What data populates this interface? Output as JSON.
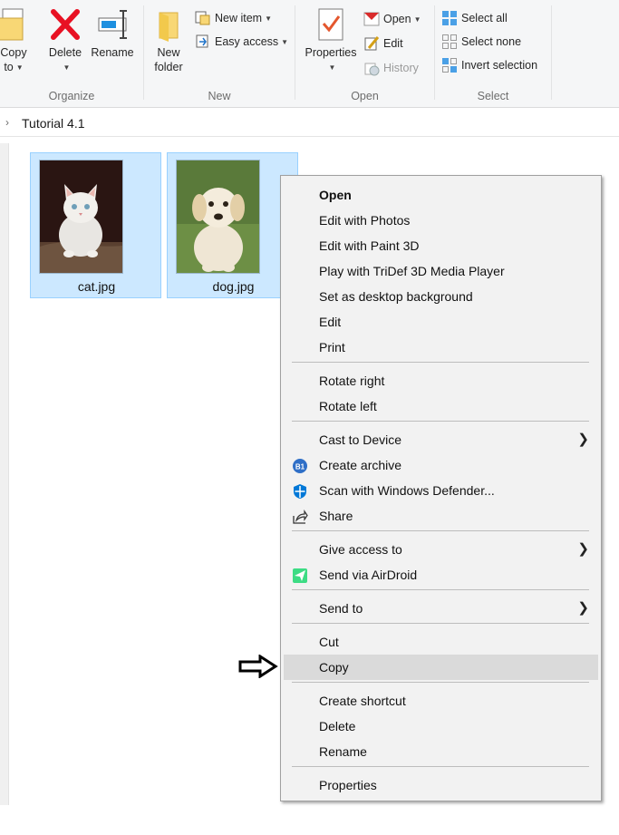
{
  "ribbon": {
    "organize": {
      "copy_to_label_1": "Copy",
      "copy_to_label_2": "to",
      "delete_label": "Delete",
      "rename_label": "Rename",
      "group_label": "Organize"
    },
    "new": {
      "new_folder_label_1": "New",
      "new_folder_label_2": "folder",
      "new_item_label": "New item",
      "easy_access_label": "Easy access",
      "group_label": "New"
    },
    "open": {
      "properties_label": "Properties",
      "open_label": "Open",
      "edit_label": "Edit",
      "history_label": "History",
      "group_label": "Open"
    },
    "select": {
      "select_all_label": "Select all",
      "select_none_label": "Select none",
      "invert_selection_label": "Invert selection",
      "group_label": "Select"
    }
  },
  "address": {
    "breadcrumb": "Tutorial 4.1"
  },
  "files": [
    {
      "name": "cat.jpg"
    },
    {
      "name": "dog.jpg"
    }
  ],
  "context_menu": {
    "items": [
      {
        "label": "Open"
      },
      {
        "label": "Edit with Photos"
      },
      {
        "label": "Edit with Paint 3D"
      },
      {
        "label": "Play with TriDef 3D Media Player"
      },
      {
        "label": "Set as desktop background"
      },
      {
        "label": "Edit"
      },
      {
        "label": "Print"
      },
      {
        "label": "Rotate right"
      },
      {
        "label": "Rotate left"
      },
      {
        "label": "Cast to Device"
      },
      {
        "label": "Create archive",
        "icon_text": "B1"
      },
      {
        "label": "Scan with Windows Defender..."
      },
      {
        "label": "Share"
      },
      {
        "label": "Give access to"
      },
      {
        "label": "Send via AirDroid"
      },
      {
        "label": "Send to"
      },
      {
        "label": "Cut"
      },
      {
        "label": "Copy"
      },
      {
        "label": "Create shortcut"
      },
      {
        "label": "Delete"
      },
      {
        "label": "Rename"
      },
      {
        "label": "Properties"
      }
    ],
    "highlighted_item": "Copy"
  },
  "colors": {
    "ribbon_bg": "#f5f6f7",
    "selection_fill": "#cce8ff",
    "selection_border": "#99d1ff",
    "menu_bg": "#f2f2f2",
    "menu_hover": "#dadada",
    "delete_red": "#e81123",
    "folder_yellow": "#f8d775",
    "airdroid_green": "#3ddc84",
    "defender_blue": "#0078d7"
  }
}
